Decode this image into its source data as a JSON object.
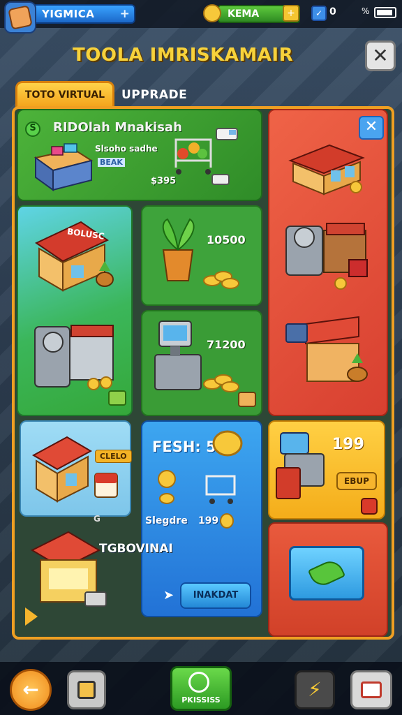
{
  "top_bar": {
    "player_name": "YIGMICA",
    "plus_label": "+",
    "currency_value": "KEMA",
    "currency_plus": "+",
    "gem_check": "✓",
    "gem_count": "0",
    "signal": "%"
  },
  "screen": {
    "title": "TOOLA IMRISKAMAIR",
    "close_label": "✕"
  },
  "tabs": [
    {
      "label": "TOTO VIRTUAL",
      "active": true
    },
    {
      "label": "UPPRADE",
      "active": false
    }
  ],
  "featured": {
    "title": "RIDOlah Mnakisah",
    "subtitle": "Slsoho sadhe",
    "tag": "BEAK",
    "price": "$395",
    "badge": "S"
  },
  "side_close_label": "✕",
  "items": {
    "plant_price": "10500",
    "register_price": "71200",
    "shop_sign": "BOLUSC",
    "shop_small_sign": "CLELO",
    "shop_tag": "G",
    "kiosk_label": "TGBOVINAI"
  },
  "blue_card": {
    "title": "FESH: 5",
    "item_label": "Slegdre",
    "item_price": "199",
    "button_label": "INAKDAT"
  },
  "yellow_card": {
    "price": "199",
    "button_label": "EBUP"
  },
  "bottom_bar": {
    "back_label": "←",
    "center_label": "PKISSISS",
    "bolt_label": "⚡"
  },
  "colors": {
    "frame": "#ef9f22",
    "title": "#f7d23b",
    "green_card": "#3ea33b",
    "red_card": "#d84030",
    "blue_card": "#2272d6",
    "yellow_card": "#f4ad1a"
  }
}
